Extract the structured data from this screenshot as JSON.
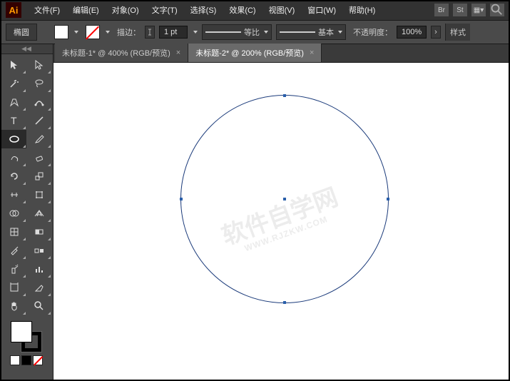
{
  "app": {
    "logo": "Ai"
  },
  "menu": {
    "file": "文件(F)",
    "edit": "编辑(E)",
    "object": "对象(O)",
    "type": "文字(T)",
    "select": "选择(S)",
    "effect": "效果(C)",
    "view": "视图(V)",
    "window": "窗口(W)",
    "help": "帮助(H)"
  },
  "menubar_right": {
    "br": "Br",
    "st": "St"
  },
  "control": {
    "tool_name": "椭圆",
    "stroke_label": "描边：",
    "stroke_pt": "1 pt",
    "profile_label": "等比",
    "brush_label": "基本",
    "opacity_label": "不透明度：",
    "opacity_value": "100%",
    "style_label": "样式"
  },
  "tabs": [
    {
      "label": "未标题-1* @ 400% (RGB/预览)",
      "close": "×",
      "active": false
    },
    {
      "label": "未标题-2* @ 200% (RGB/预览)",
      "close": "×",
      "active": true
    }
  ],
  "watermark": {
    "main": "软件自学网",
    "sub": "WWW.RJZKW.COM"
  }
}
